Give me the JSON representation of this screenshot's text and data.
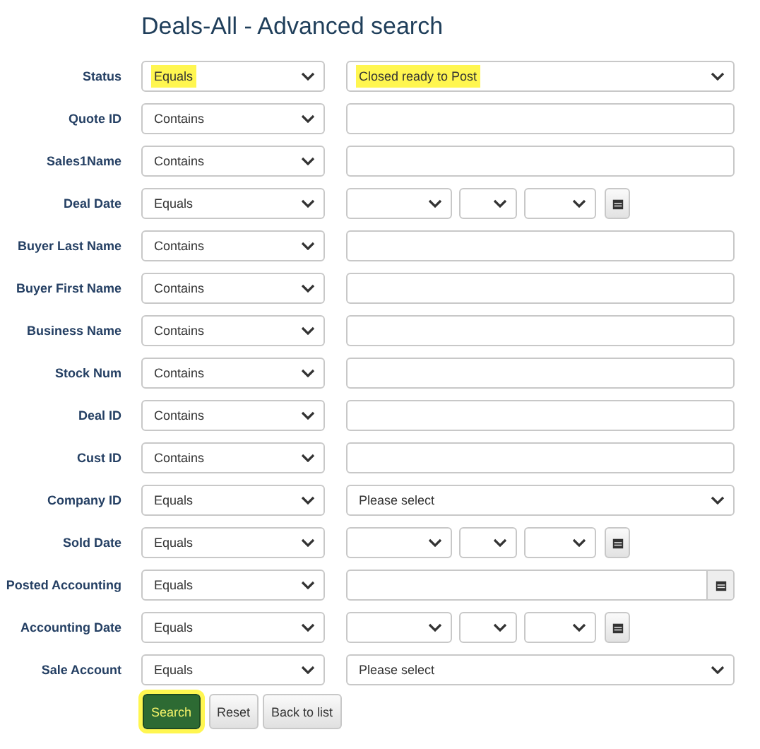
{
  "title": "Deals-All - Advanced search",
  "fields": [
    {
      "label": "Status",
      "kind": "select",
      "operator": "Equals",
      "operator_highlighted": true,
      "value": "Closed ready to Post",
      "value_highlighted": true
    },
    {
      "label": "Quote ID",
      "kind": "text",
      "operator": "Contains",
      "operator_highlighted": false,
      "value_highlighted": false
    },
    {
      "label": "Sales1Name",
      "kind": "text",
      "operator": "Contains",
      "operator_highlighted": false,
      "value_highlighted": false
    },
    {
      "label": "Deal Date",
      "kind": "date",
      "operator": "Equals",
      "operator_highlighted": false,
      "value_highlighted": false
    },
    {
      "label": "Buyer Last Name",
      "kind": "text",
      "operator": "Contains",
      "operator_highlighted": false,
      "value_highlighted": false
    },
    {
      "label": "Buyer First Name",
      "kind": "text",
      "operator": "Contains",
      "operator_highlighted": false,
      "value_highlighted": false
    },
    {
      "label": "Business Name",
      "kind": "text",
      "operator": "Contains",
      "operator_highlighted": false,
      "value_highlighted": false
    },
    {
      "label": "Stock Num",
      "kind": "text",
      "operator": "Contains",
      "operator_highlighted": false,
      "value_highlighted": false
    },
    {
      "label": "Deal ID",
      "kind": "text",
      "operator": "Contains",
      "operator_highlighted": false,
      "value_highlighted": false
    },
    {
      "label": "Cust ID",
      "kind": "text",
      "operator": "Contains",
      "operator_highlighted": false,
      "value_highlighted": false
    },
    {
      "label": "Company ID",
      "kind": "select",
      "operator": "Equals",
      "operator_highlighted": false,
      "value": "Please select",
      "value_highlighted": false
    },
    {
      "label": "Sold Date",
      "kind": "date",
      "operator": "Equals",
      "operator_highlighted": false,
      "value_highlighted": false
    },
    {
      "label": "Posted Accounting",
      "kind": "datepicker",
      "operator": "Equals",
      "operator_highlighted": false,
      "value_highlighted": false
    },
    {
      "label": "Accounting Date",
      "kind": "date",
      "operator": "Equals",
      "operator_highlighted": false,
      "value_highlighted": false
    },
    {
      "label": "Sale Account",
      "kind": "select",
      "operator": "Equals",
      "operator_highlighted": false,
      "value": "Please select",
      "value_highlighted": false
    }
  ],
  "buttons": [
    {
      "label": "Search",
      "kind": "primary",
      "highlighted": true
    },
    {
      "label": "Reset",
      "kind": "default",
      "highlighted": false
    },
    {
      "label": "Back to list",
      "kind": "default",
      "highlighted": false
    }
  ]
}
